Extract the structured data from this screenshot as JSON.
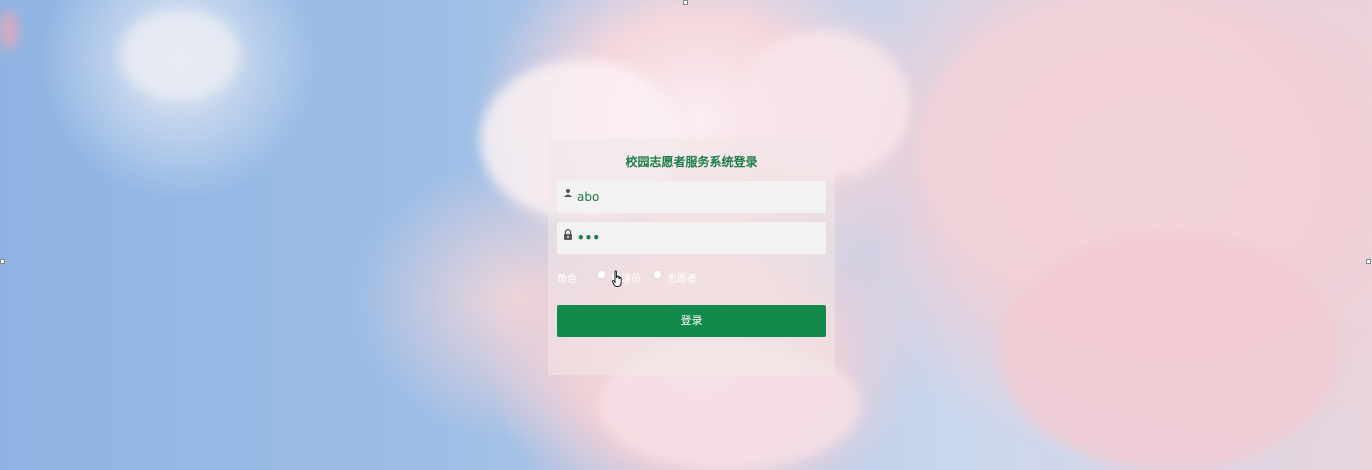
{
  "login": {
    "title": "校园志愿者服务系统登录",
    "username_value": "abo",
    "password_value": "•••",
    "role_label": "角色",
    "role_options": [
      "管理员",
      "志愿者"
    ],
    "submit_label": "登录"
  },
  "icons": {
    "username": "user-icon",
    "password": "lock-icon"
  },
  "colors": {
    "accent": "#138a4c",
    "title": "#1e7d48"
  }
}
